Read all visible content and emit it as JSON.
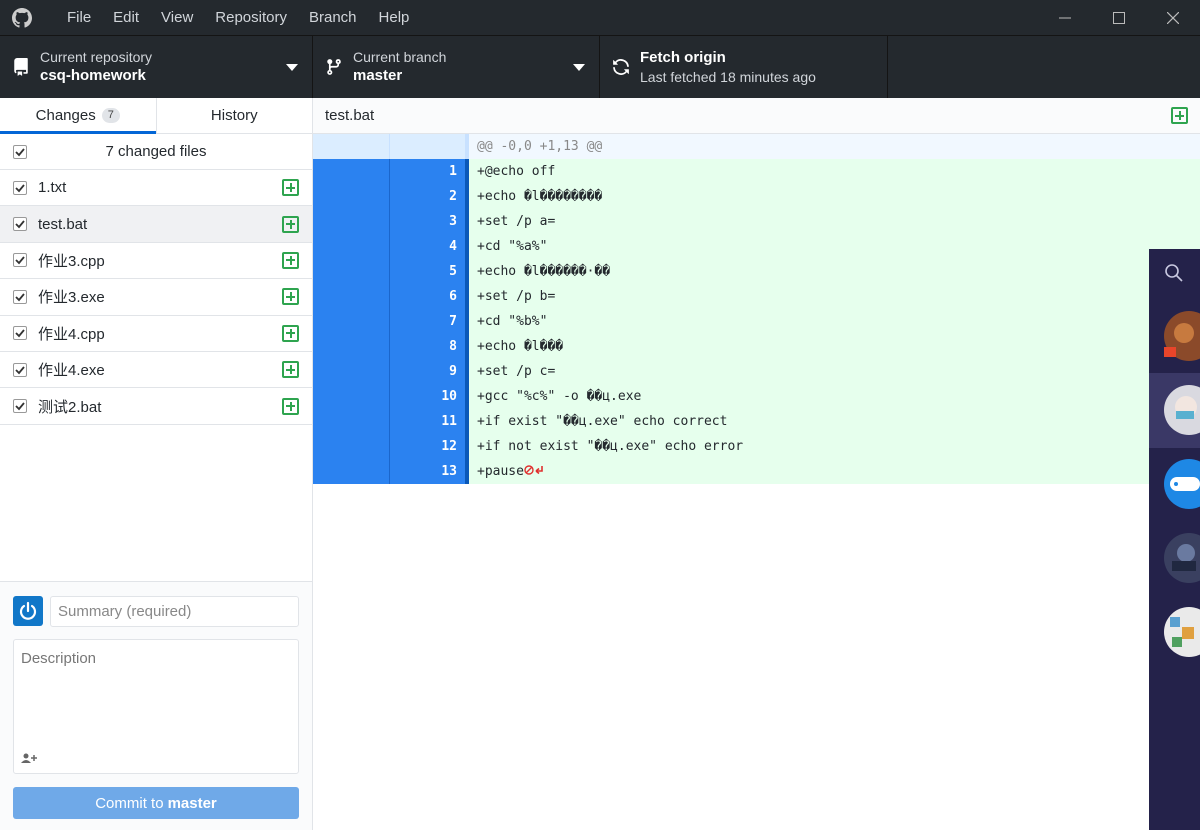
{
  "menu": [
    "File",
    "Edit",
    "View",
    "Repository",
    "Branch",
    "Help"
  ],
  "toolbar": {
    "repo_label": "Current repository",
    "repo_value": "csq-homework",
    "branch_label": "Current branch",
    "branch_value": "master",
    "fetch_label": "Fetch origin",
    "fetch_sub": "Last fetched 18 minutes ago"
  },
  "tabs": {
    "changes_label": "Changes",
    "changes_count": "7",
    "history_label": "History"
  },
  "files": {
    "header": "7 changed files",
    "items": [
      {
        "name": "1.txt"
      },
      {
        "name": "test.bat"
      },
      {
        "name": "作业3.cpp"
      },
      {
        "name": "作业3.exe"
      },
      {
        "name": "作业4.cpp"
      },
      {
        "name": "作业4.exe"
      },
      {
        "name": "测试2.bat"
      }
    ]
  },
  "commit": {
    "summary_placeholder": "Summary (required)",
    "description_placeholder": "Description",
    "button_prefix": "Commit to",
    "button_branch": "master"
  },
  "diff": {
    "filename": "test.bat",
    "hunk": "@@ -0,0 +1,13 @@",
    "lines": [
      {
        "n": "1",
        "text": "+@echo off"
      },
      {
        "n": "2",
        "text": "+echo �l�����ؘ���"
      },
      {
        "n": "3",
        "text": "+set /p a="
      },
      {
        "n": "4",
        "text": "+cd \"%a%\""
      },
      {
        "n": "5",
        "text": "+echo �l������·��"
      },
      {
        "n": "6",
        "text": "+set /p b="
      },
      {
        "n": "7",
        "text": "+cd \"%b%\""
      },
      {
        "n": "8",
        "text": "+echo �l���"
      },
      {
        "n": "9",
        "text": "+set /p c="
      },
      {
        "n": "10",
        "text": "+gcc \"%c%\" -o ��ц.exe"
      },
      {
        "n": "11",
        "text": "+if exist \"��ц.exe\" echo correct"
      },
      {
        "n": "12",
        "text": "+if not exist \"��ц.exe\" echo error"
      },
      {
        "n": "13",
        "text": "+pause"
      }
    ]
  },
  "icons": {
    "app": "github-icon",
    "repo": "repo-icon",
    "branch": "branch-icon",
    "fetch": "sync-icon",
    "add": "plus-square-icon",
    "eol": "no-newline-icon"
  },
  "colors": {
    "titlebar": "#24292e",
    "accent": "#0366d6",
    "added_bg": "#e6ffed",
    "line_selected": "#2b82f0",
    "add_icon": "#2ea44f",
    "commit_button": "#6fa9e8"
  }
}
